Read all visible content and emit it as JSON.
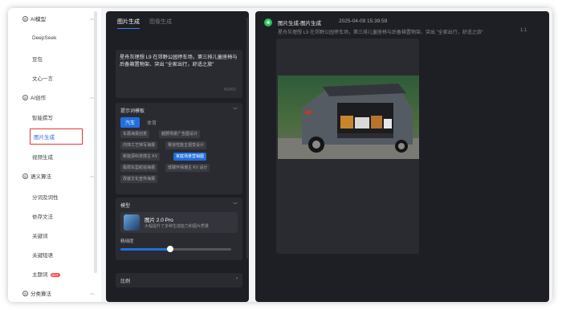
{
  "sidebar": {
    "groups": [
      {
        "label": "AI模型",
        "icon": "ai-model-icon"
      },
      {
        "label": "AI创作",
        "icon": "ai-create-icon"
      },
      {
        "label": "语义算法",
        "icon": "semantic-icon"
      },
      {
        "label": "分类算法",
        "icon": "classify-icon"
      }
    ],
    "items": [
      "DeepSeek",
      "豆包",
      "文心一言",
      "智能撰写",
      "图片生成",
      "视频生成",
      "分词及词性",
      "依存文法",
      "关键词",
      "关键短语",
      "主题词"
    ],
    "hot_badge": "HOT"
  },
  "middle": {
    "tabs": [
      "图片生成",
      "图像生成"
    ],
    "prompt_text": "星舟灰理想 L9 在郊野公园停车场，第三排儿童座椅与后备箱置物架、突出 \"全家出行，舒适之旅\"",
    "prompt_count": "40/800",
    "template_section_title": "提示词模板",
    "template_tabs": [
      "汽车",
      "体育"
    ],
    "chips": [
      "车展海报创意",
      "越野场景广告图设计",
      "内饰工艺特写海报",
      "赛道性能主视觉设计",
      "新能源科技感主 KV",
      "家庭场景营销图",
      "极限车型航拍海报",
      "低碳环保潮主 KV 设计",
      "改装文化宣传海报"
    ],
    "model_section_title": "模型",
    "model_name": "图片 2.0 Pro",
    "model_desc": "大幅提升了多种生成能力和图片质量",
    "slider_label": "精细度",
    "slider_value": 0.45,
    "ratio_section_title": "比例"
  },
  "result": {
    "title": "图片生成-图片生成",
    "time": "2025-04-09 15:39:59",
    "prompt": "星舟灰理想 L9 在郊野公园停车场，第三排儿童座椅与后备箱置物架、突出 \"全家出行，舒适之旅\"",
    "ratio": "1:1"
  },
  "colors": {
    "accent": "#1f6fe0",
    "active_border": "#e53935",
    "panel": "#1e1f24"
  }
}
